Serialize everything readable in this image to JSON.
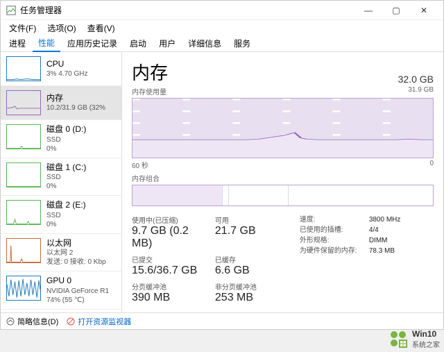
{
  "titlebar": {
    "title": "任务管理器"
  },
  "menu": {
    "file": "文件(F)",
    "options": "选项(O)",
    "view": "查看(V)"
  },
  "tabs": {
    "processes": "进程",
    "performance": "性能",
    "apphistory": "应用历史记录",
    "startup": "启动",
    "users": "用户",
    "details": "详细信息",
    "services": "服务"
  },
  "sidebar": {
    "cpu": {
      "title": "CPU",
      "sub": "3%  4.70 GHz"
    },
    "memory": {
      "title": "内存",
      "sub": "10.2/31.9 GB (32%"
    },
    "disk0": {
      "title": "磁盘 0 (D:)",
      "sub1": "SSD",
      "sub2": "0%"
    },
    "disk1": {
      "title": "磁盘 1 (C:)",
      "sub1": "SSD",
      "sub2": "0%"
    },
    "disk2": {
      "title": "磁盘 2 (E:)",
      "sub1": "SSD",
      "sub2": "0%"
    },
    "ethernet": {
      "title": "以太网",
      "sub1": "以太网 2",
      "sub2": "发送: 0  接收: 0 Kbp"
    },
    "gpu": {
      "title": "GPU 0",
      "sub1": "NVIDIA GeForce R1",
      "sub2": "74%  (55 ℃)"
    }
  },
  "main": {
    "title": "内存",
    "capacity": "32.0 GB",
    "usage_label": "内存使用量",
    "usage_max": "31.9 GB",
    "scale_left": "60 秒",
    "scale_right": "0",
    "comp_label": "内存组合",
    "stats": {
      "inuse_lbl": "使用中(已压缩)",
      "inuse": "9.7 GB (0.2 MB)",
      "avail_lbl": "可用",
      "avail": "21.7 GB",
      "committed_lbl": "已提交",
      "committed": "15.6/36.7 GB",
      "cached_lbl": "已缓存",
      "cached": "6.6 GB",
      "paged_lbl": "分页缓冲池",
      "paged": "390 MB",
      "nonpaged_lbl": "非分页缓冲池",
      "nonpaged": "253 MB"
    },
    "kv": {
      "speed_k": "速度:",
      "speed_v": "3800 MHz",
      "slots_k": "已使用的插槽:",
      "slots_v": "4/4",
      "form_k": "外形规格:",
      "form_v": "DIMM",
      "reserved_k": "为硬件保留的内存:",
      "reserved_v": "78.3 MB"
    }
  },
  "footer": {
    "collapse": "简略信息(D)",
    "link": "打开资源监视器"
  },
  "watermark": {
    "t": "Win10",
    "s": "系统之家"
  },
  "chart_data": {
    "type": "line",
    "title": "内存使用量",
    "xlabel": "秒",
    "ylabel": "GB",
    "xlim": [
      60,
      0
    ],
    "ylim": [
      0,
      31.9
    ],
    "series": [
      {
        "name": "内存",
        "x": [
          60,
          55,
          50,
          45,
          40,
          35,
          30,
          28,
          26,
          24,
          22,
          20,
          18,
          16,
          14,
          12,
          10,
          8,
          6,
          4,
          2,
          0
        ],
        "values": [
          9.5,
          9.5,
          9.6,
          9.6,
          9.6,
          9.6,
          9.7,
          10.0,
          11.3,
          10.4,
          9.9,
          9.8,
          9.7,
          9.7,
          9.7,
          9.7,
          9.7,
          9.7,
          9.6,
          9.8,
          9.7,
          9.7
        ]
      }
    ]
  }
}
